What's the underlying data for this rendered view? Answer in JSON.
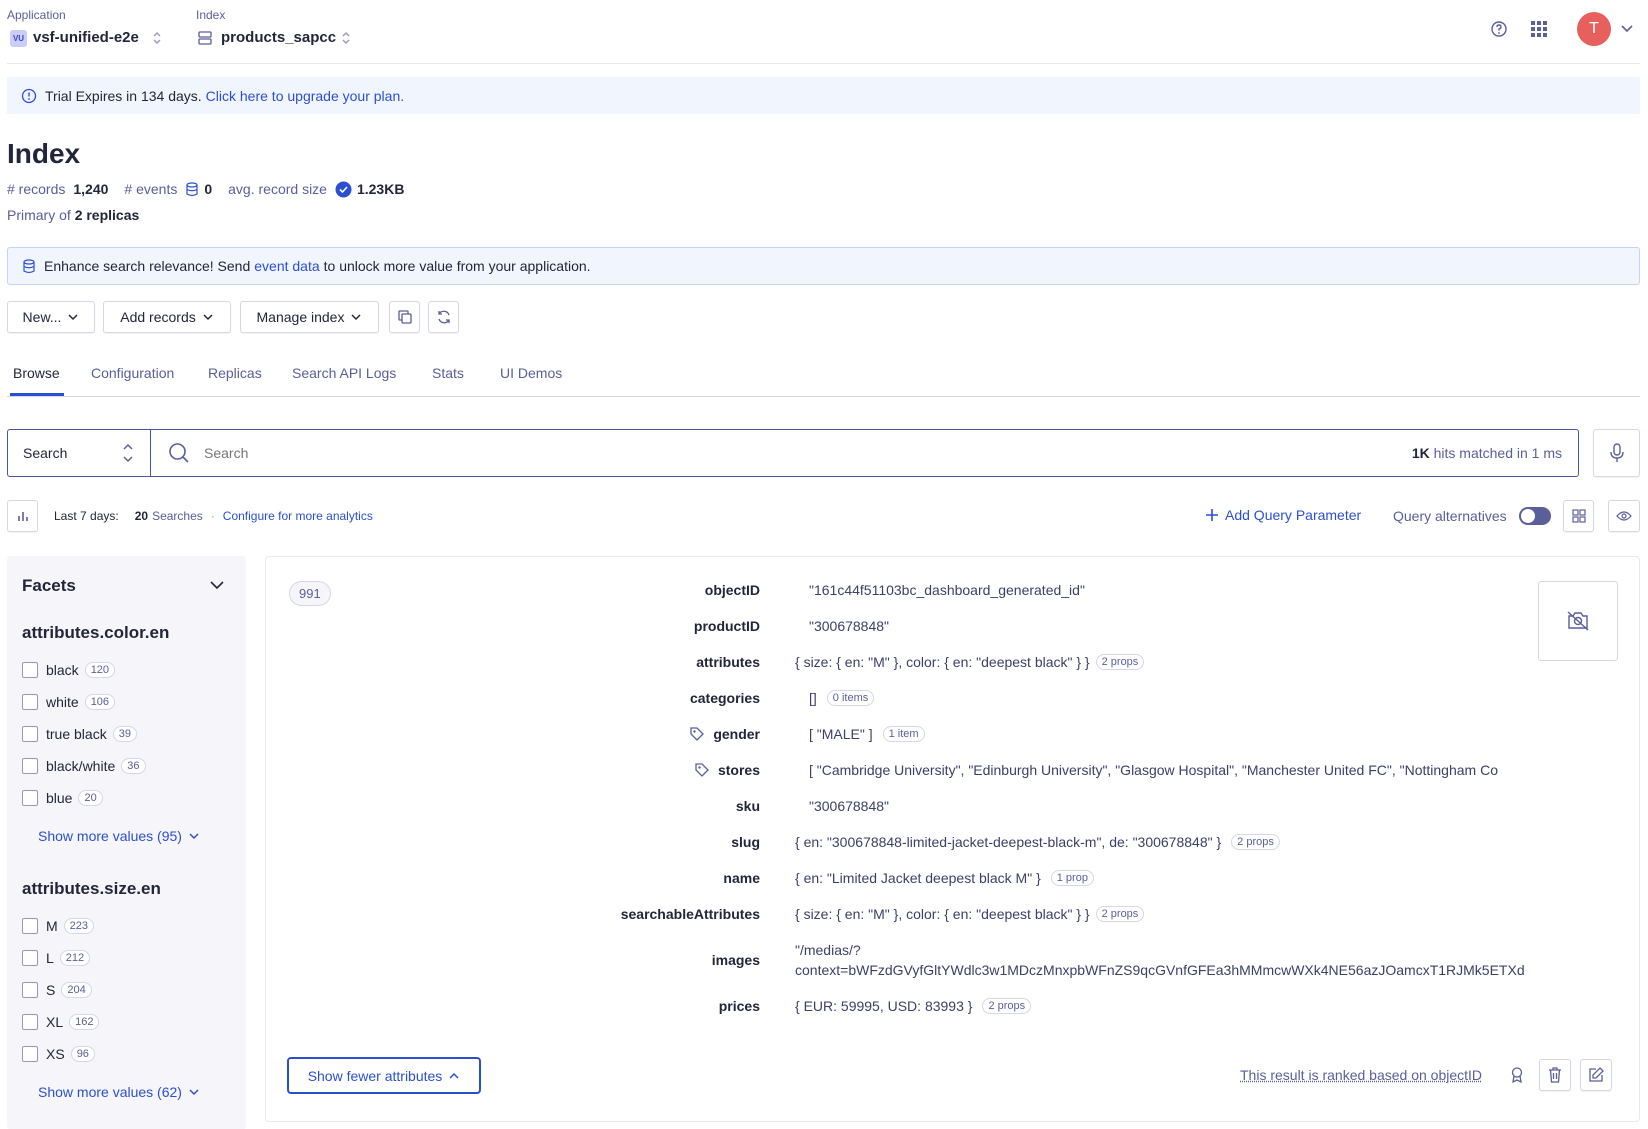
{
  "topbar": {
    "application_label": "Application",
    "application_badge": "VU",
    "application_value": "vsf-unified-e2e",
    "index_label": "Index",
    "index_value": "products_sapcc",
    "avatar_letter": "T"
  },
  "trial_banner": {
    "text": "Trial Expires in 134 days.",
    "link": "Click here to upgrade your plan."
  },
  "page": {
    "title": "Index",
    "records_label": "# records",
    "records_value": "1,240",
    "events_label": "# events",
    "events_value": "0",
    "avg_size_label": "avg. record size",
    "avg_size_value": "1.23KB",
    "primary_prefix": "Primary of",
    "primary_value": "2 replicas"
  },
  "relevance_banner": {
    "text_before": "Enhance search relevance! Send",
    "link": "event data",
    "text_after": "to unlock more value from your application."
  },
  "toolbar": {
    "new_label": "New...",
    "add_records_label": "Add records",
    "manage_index_label": "Manage index"
  },
  "tabs": [
    {
      "label": "Browse",
      "active": true
    },
    {
      "label": "Configuration",
      "active": false
    },
    {
      "label": "Replicas",
      "active": false
    },
    {
      "label": "Search API Logs",
      "active": false
    },
    {
      "label": "Stats",
      "active": false
    },
    {
      "label": "UI Demos",
      "active": false
    }
  ],
  "search": {
    "mode": "Search",
    "placeholder": "Search",
    "hits_count": "1K",
    "hits_text": "hits matched in 1 ms"
  },
  "analytics": {
    "period": "Last 7 days:",
    "count": "20",
    "count_label": "Searches",
    "separator": "·",
    "configure_link": "Configure for more analytics",
    "add_query_param": "Add Query Parameter",
    "query_alternatives": "Query alternatives"
  },
  "facets": {
    "title": "Facets",
    "groups": [
      {
        "name": "attributes.color.en",
        "items": [
          {
            "label": "black",
            "count": "120"
          },
          {
            "label": "white",
            "count": "106"
          },
          {
            "label": "true black",
            "count": "39"
          },
          {
            "label": "black/white",
            "count": "36"
          },
          {
            "label": "blue",
            "count": "20"
          }
        ],
        "show_more": "Show more values (95)"
      },
      {
        "name": "attributes.size.en",
        "items": [
          {
            "label": "M",
            "count": "223"
          },
          {
            "label": "L",
            "count": "212"
          },
          {
            "label": "S",
            "count": "204"
          },
          {
            "label": "XL",
            "count": "162"
          },
          {
            "label": "XS",
            "count": "96"
          }
        ],
        "show_more": "Show more values (62)"
      }
    ]
  },
  "record": {
    "position": "991",
    "attributes": [
      {
        "key": "objectID",
        "value": "\"161c44f51103bc_dashboard_generated_id\"",
        "badge": "",
        "tag": false
      },
      {
        "key": "productID",
        "value": "\"300678848\"",
        "badge": "",
        "tag": false
      },
      {
        "key": "attributes",
        "value": "{ size: { en: \"M\" }, color: { en: \"deepest black\" } }",
        "badge": "2 props",
        "tag": false
      },
      {
        "key": "categories",
        "value": "[]",
        "badge": "0 items",
        "tag": false
      },
      {
        "key": "gender",
        "value": "[ \"MALE\" ]",
        "badge": "1 item",
        "tag": true
      },
      {
        "key": "stores",
        "value": "[ \"Cambridge University\", \"Edinburgh University\", \"Glasgow Hospital\", \"Manchester United FC\", \"Nottingham Co",
        "badge": "",
        "tag": true
      },
      {
        "key": "sku",
        "value": "\"300678848\"",
        "badge": "",
        "tag": false
      },
      {
        "key": "slug",
        "value": "{ en: \"300678848-limited-jacket-deepest-black-m\", de: \"300678848\" }",
        "badge": "2 props",
        "tag": false
      },
      {
        "key": "name",
        "value": "{ en: \"Limited Jacket deepest black M\" }",
        "badge": "1 prop",
        "tag": false
      },
      {
        "key": "searchableAttributes",
        "value": "{ size: { en: \"M\" }, color: { en: \"deepest black\" } }",
        "badge": "2 props",
        "tag": false
      },
      {
        "key": "images",
        "value": "\"/medias/?",
        "value2": "context=bWFzdGVyfGltYWdlc3w1MDczMnxpbWFnZS9qcGVnfGFEa3hMMmcwWXk4NE56azJOamcxT1RJMk5ETXd",
        "badge": "",
        "tag": false
      },
      {
        "key": "prices",
        "value": "{ EUR: 59995, USD: 83993 }",
        "badge": "2 props",
        "tag": false
      }
    ],
    "show_fewer": "Show fewer attributes",
    "ranked_text": "This result is ranked based on objectID"
  },
  "colors": {
    "accent": "#2b4fd3",
    "text": "#23263b",
    "muted": "#5a5e9a",
    "avatar": "#e8605d",
    "banner_bg": "#f1f5fe"
  }
}
